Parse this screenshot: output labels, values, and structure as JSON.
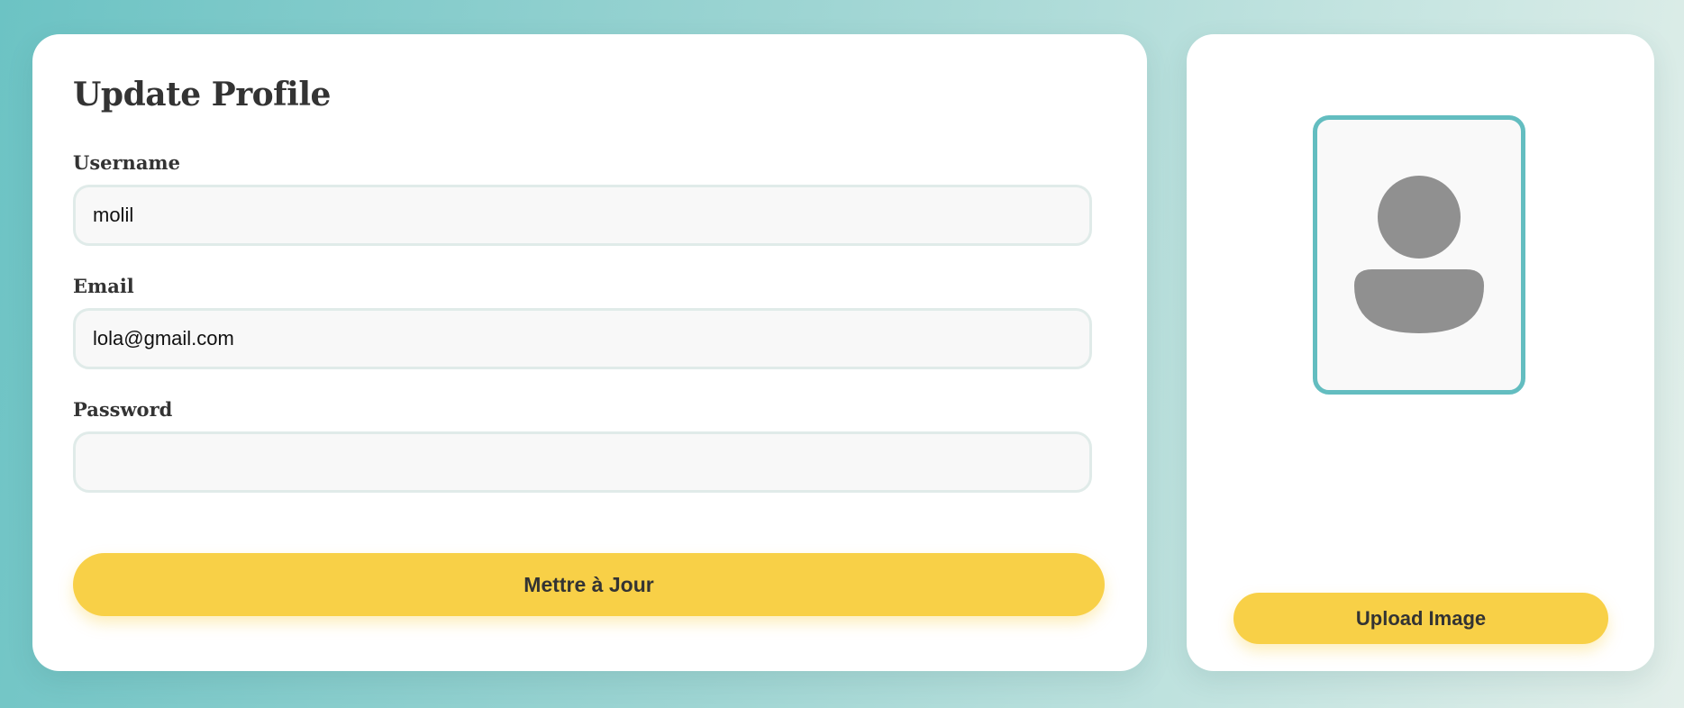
{
  "form": {
    "title": "Update Profile",
    "username": {
      "label": "Username",
      "value": "molil"
    },
    "email": {
      "label": "Email",
      "value": "lola@gmail.com"
    },
    "password": {
      "label": "Password",
      "value": ""
    },
    "submit_label": "Mettre à Jour"
  },
  "image_panel": {
    "avatar_icon": "user-placeholder-icon",
    "upload_label": "Upload Image"
  },
  "colors": {
    "accent_yellow": "#f8d047",
    "accent_teal": "#63bdc0",
    "avatar_gray": "#909090",
    "text_dark": "#333333"
  }
}
